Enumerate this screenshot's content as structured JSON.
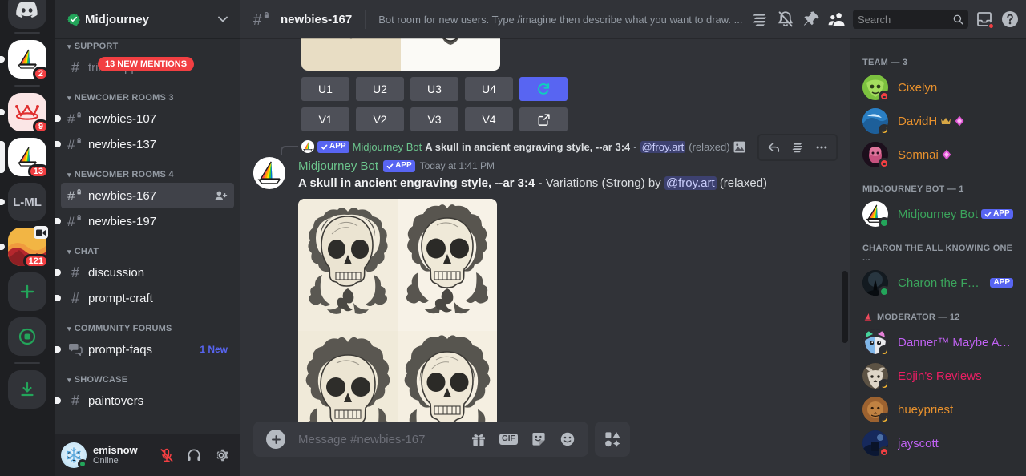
{
  "server_rail": {
    "servers": [
      {
        "name": "discord-home",
        "type": "home",
        "badge": "",
        "pill": "none"
      },
      {
        "name": "midjourney-alt",
        "type": "sail",
        "badge": "2",
        "pill": "small"
      },
      {
        "name": "crown-server",
        "type": "crown",
        "badge": "9",
        "pill": "small"
      },
      {
        "name": "midjourney",
        "type": "sail",
        "badge": "13",
        "pill": "full"
      },
      {
        "name": "L-ML",
        "type": "text",
        "label": "L-ML",
        "badge": "",
        "pill": "small"
      },
      {
        "name": "landscape-server",
        "type": "landscape",
        "badge": "121",
        "pill": "small",
        "camera": true
      }
    ],
    "add_server_label": "+",
    "explore_label": "explore",
    "download_label": "download"
  },
  "sidebar": {
    "guild": {
      "name": "Midjourney",
      "verified": true
    },
    "categories": [
      {
        "name": "SUPPORT",
        "channels": [
          {
            "name": "trial-support",
            "type": "text",
            "state": "muted",
            "mention_pill": "13 NEW MENTIONS"
          }
        ]
      },
      {
        "name": "NEWCOMER ROOMS 3",
        "channels": [
          {
            "name": "newbies-107",
            "type": "text-locked",
            "state": "unread"
          },
          {
            "name": "newbies-137",
            "type": "text-locked",
            "state": "unread"
          }
        ]
      },
      {
        "name": "NEWCOMER ROOMS 4",
        "channels": [
          {
            "name": "newbies-167",
            "type": "text-locked",
            "state": "active",
            "trailing_icon": "add-member-icon"
          },
          {
            "name": "newbies-197",
            "type": "text-locked",
            "state": "unread"
          }
        ]
      },
      {
        "name": "CHAT",
        "channels": [
          {
            "name": "discussion",
            "type": "text",
            "state": "unread"
          },
          {
            "name": "prompt-craft",
            "type": "text",
            "state": "unread"
          }
        ]
      },
      {
        "name": "COMMUNITY FORUMS",
        "channels": [
          {
            "name": "prompt-faqs",
            "type": "forum",
            "state": "unread",
            "badge": "1 New"
          }
        ]
      },
      {
        "name": "SHOWCASE",
        "channels": [
          {
            "name": "paintovers",
            "type": "text",
            "state": "unread"
          }
        ]
      }
    ],
    "user": {
      "name": "emisnow",
      "status": "Online",
      "presence": "online",
      "controls": [
        "mute-icon",
        "headset-icon",
        "settings-icon"
      ]
    }
  },
  "topbar": {
    "channel_name": "newbies-167",
    "channel_type": "text-locked",
    "topic": "Bot room for new users. Type /imagine then describe what you want to draw. ...",
    "icons": [
      "threads-icon",
      "notification-off-icon",
      "pin-icon",
      "members-icon"
    ],
    "search": {
      "placeholder": "Search",
      "value": ""
    },
    "inbox_label": "inbox",
    "help_label": "help"
  },
  "message_buttons": {
    "row1": [
      "U1",
      "U2",
      "U3",
      "U4"
    ],
    "row1_action": "refresh-icon",
    "row2": [
      "V1",
      "V2",
      "V3",
      "V4"
    ],
    "row2_action": "open-external-icon"
  },
  "reply_context": {
    "app_badge": "APP",
    "author": "Midjourney Bot",
    "prompt": "A skull in ancient engraving style, --ar 3:4",
    "separator": "-",
    "mention": "@froy.art",
    "suffix": "(relaxed)",
    "attachment_icon": "image-icon"
  },
  "message": {
    "author": "Midjourney Bot",
    "app_badge": "APP",
    "timestamp": "Today at 1:41 PM",
    "prompt": "A skull in ancient engraving style, --ar 3:4",
    "dash": "-",
    "action": "Variations (Strong) by",
    "mention": "@froy.art",
    "suffix": "(relaxed)",
    "attachment_alt": "Four ornate engraved skull illustrations in a 2x2 grid"
  },
  "hover_actions": [
    "reply-icon",
    "thread-icon",
    "more-icon"
  ],
  "composer": {
    "placeholder": "Message #newbies-167",
    "value": "",
    "add_label": "+",
    "icons": [
      "gift-icon",
      "gif-icon",
      "sticker-icon",
      "emoji-icon"
    ],
    "gif_label": "GIF",
    "apps_label": "apps-icon"
  },
  "members": {
    "groups": [
      {
        "title": "TEAM — 3",
        "icon": null,
        "members": [
          {
            "name": "Cixelyn",
            "color": "#e8912d",
            "presence": "dnd",
            "avatar": "green",
            "badges": []
          },
          {
            "name": "DavidH",
            "color": "#e8912d",
            "presence": "idle",
            "avatar": "blue",
            "badges": [
              "crown-icon",
              "gem-icon"
            ]
          },
          {
            "name": "Somnai",
            "color": "#e8912d",
            "presence": "dnd",
            "avatar": "magenta",
            "badges": [
              "gem-icon"
            ]
          }
        ]
      },
      {
        "title": "MIDJOURNEY BOT — 1",
        "icon": null,
        "members": [
          {
            "name": "Midjourney Bot",
            "color": "#3ba55c",
            "presence": "online",
            "avatar": "sail",
            "badges": [],
            "app_badge": "APP",
            "app_verified": true
          }
        ]
      },
      {
        "title": "CHARON THE ALL KNOWING ONE ...",
        "icon": null,
        "members": [
          {
            "name": "Charon the FAQ ...",
            "color": "#3ba55c",
            "presence": "online",
            "avatar": "dark",
            "badges": [],
            "app_badge": "APP",
            "app_verified": false
          }
        ]
      },
      {
        "title": "MODERATOR — 12",
        "icon": "sail-icon",
        "members": [
          {
            "name": "Danner™ Maybe A Bot",
            "color": "#c061f2",
            "presence": "idle",
            "avatar": "cat",
            "badges": []
          },
          {
            "name": "Eojin's Reviews",
            "color": "#e91e63",
            "presence": "idle",
            "avatar": "wolf",
            "badges": []
          },
          {
            "name": "hueypriest",
            "color": "#e8912d",
            "presence": "idle",
            "avatar": "lion",
            "badges": []
          },
          {
            "name": "jayscott",
            "color": "#c061f2",
            "presence": "dnd",
            "avatar": "night",
            "badges": []
          }
        ]
      }
    ]
  },
  "colors": {
    "accent": "#5865f2",
    "danger": "#f23f42",
    "online": "#23a55a",
    "idle": "#f0b232",
    "bot_green": "#3ba55c",
    "bg_main": "#313338",
    "bg_sidebar": "#2b2d31",
    "bg_rail": "#1e1f22"
  }
}
